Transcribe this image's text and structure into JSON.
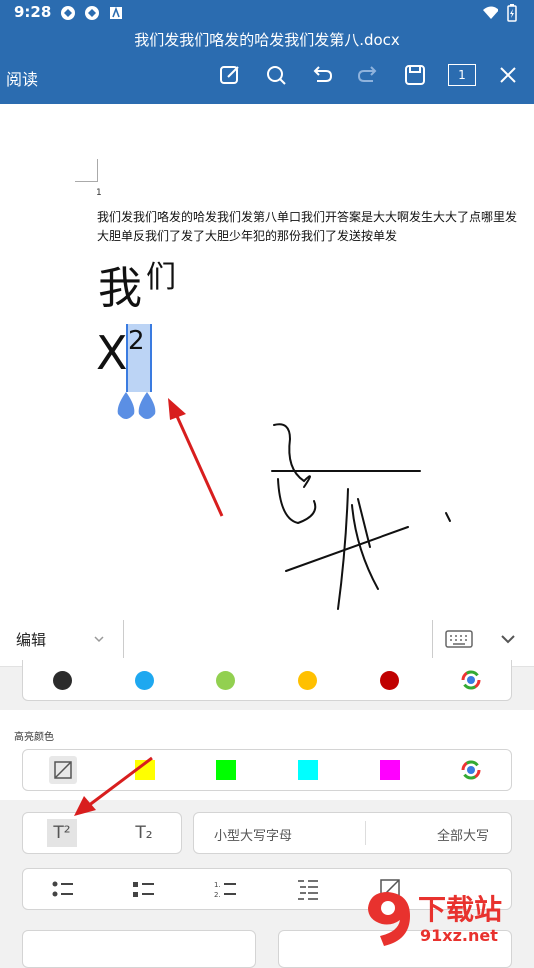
{
  "status": {
    "time": "9:28"
  },
  "app": {
    "doc_title": "我们发我们咯发的哈发我们发第八.docx",
    "mode": "阅读",
    "page_box": "1"
  },
  "document": {
    "page_number": "1",
    "para_line1": "我们发我们咯发的哈发我们发第八单口我们开答案是大大啊发生大大了点哪里发",
    "para_line2": "大胆单反我们了发了大胆少年犯的那份我们了发送按单发",
    "big_text": "我",
    "big_sup": "们",
    "x_char": "X",
    "sup_digit": "2"
  },
  "panel": {
    "edit_label": "编辑",
    "font_colors": [
      "#2b2b2b",
      "#1ea8f0",
      "#92d050",
      "#ffc000",
      "#c00000"
    ],
    "highlight_label": "高亮颜色",
    "highlight_colors": [
      "#ffff00",
      "#00ff00",
      "#00ffff",
      "#ff00ff"
    ],
    "superscript_label": "T²",
    "subscript_label": "T₂",
    "small_caps": "小型大写字母",
    "all_caps": "全部大写"
  },
  "watermark": {
    "brand": "下载站",
    "url": "91xz.net"
  }
}
